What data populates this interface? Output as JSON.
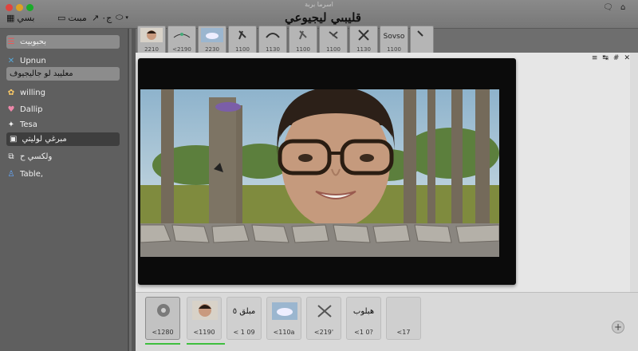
{
  "window": {
    "title": "اسرما بربة",
    "doc_title": "قليبىي ليجيوعي"
  },
  "toolbar": {
    "menu_label": "بسي",
    "item2_label": "مبىت",
    "item3_label": "ج٠",
    "right_icon": "comment-icon"
  },
  "sidebar": {
    "items": [
      {
        "label": "بحبوبيت",
        "icon": "list-icon"
      },
      {
        "label": "Upnun",
        "icon": "person-icon",
        "sub": "معليبد لو جاليجيوف"
      },
      {
        "label": "willing",
        "icon": "palette-icon"
      },
      {
        "label": "Dallip",
        "icon": "heart-icon"
      },
      {
        "label": "Tesa",
        "icon": "sparkle-icon",
        "sub": "مبرغي لوليتي"
      },
      {
        "label": "ولكسي ح",
        "icon": "layers-icon"
      },
      {
        "label": "Table,",
        "icon": "person-icon"
      }
    ]
  },
  "top_thumbs": [
    {
      "caption": "2210",
      "kind": "face"
    },
    {
      "caption": "<2190",
      "kind": "plant"
    },
    {
      "caption": "2230",
      "kind": "cloud"
    },
    {
      "caption": "1100",
      "kind": "pin"
    },
    {
      "caption": "1130",
      "kind": "arc"
    },
    {
      "caption": "1100",
      "kind": "pin"
    },
    {
      "caption": "1100",
      "kind": "pin"
    },
    {
      "caption": "1130",
      "kind": "x"
    },
    {
      "caption": "1100",
      "kind": "text",
      "text": "Sovso"
    },
    {
      "caption": "",
      "kind": "pin"
    }
  ],
  "bottom_thumbs": [
    {
      "caption": "<1280",
      "kind": "gear",
      "selected": true
    },
    {
      "caption": "<1190",
      "kind": "face"
    },
    {
      "caption": "< 1 09",
      "kind": "text",
      "text": "مبلق ٥"
    },
    {
      "caption": "<110a",
      "kind": "cloud"
    },
    {
      "caption": "<219'",
      "kind": "x"
    },
    {
      "caption": "<1 0?",
      "kind": "text",
      "text": "هبلوب"
    },
    {
      "caption": "<17",
      "kind": "dot"
    }
  ],
  "canvas_tools": [
    "≡",
    "↹",
    "#",
    "✕"
  ],
  "colors": {
    "accent_green": "#3fbf3f",
    "stage": "#0b0b0b"
  }
}
